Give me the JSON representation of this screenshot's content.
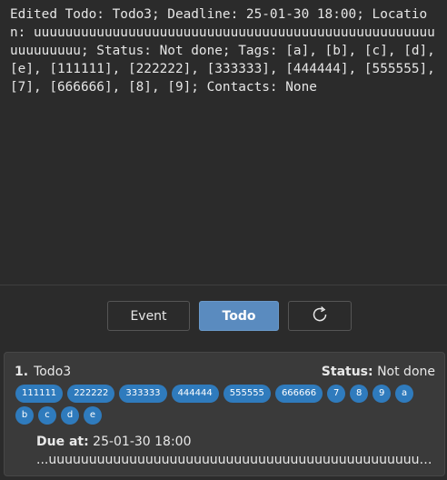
{
  "console": {
    "text": "Edited Todo: Todo3; Deadline: 25-01-30 18:00; Location: uuuuuuuuuuuuuuuuuuuuuuuuuuuuuuuuuuuuuuuuuuuuuuuuuuuuuuuuuuuu; Status: Not done; Tags: [a], [b], [c], [d], [e], [111111], [222222], [333333], [444444], [555555], [7], [666666], [8], [9]; Contacts: None"
  },
  "toolbar": {
    "event_label": "Event",
    "todo_label": "Todo",
    "refresh_icon": "refresh-icon"
  },
  "item": {
    "index": "1.",
    "title": "Todo3",
    "status_key": "Status:",
    "status_value": "Not done",
    "tags": [
      "111111",
      "222222",
      "333333",
      "444444",
      "555555",
      "666666",
      "7",
      "8",
      "9",
      "a",
      "b",
      "c",
      "d",
      "e"
    ],
    "due_key": "Due at:",
    "due_value": "25-01-30 18:00",
    "location": "...uuuuuuuuuuuuuuuuuuuuuuuuuuuuuuuuuuuuuuuuuuuuuuuuuuu..."
  },
  "colors": {
    "background": "#2b2b2b",
    "panel": "#3a3a3a",
    "accent": "#5a8bbf",
    "tag": "#2f7bbd"
  }
}
